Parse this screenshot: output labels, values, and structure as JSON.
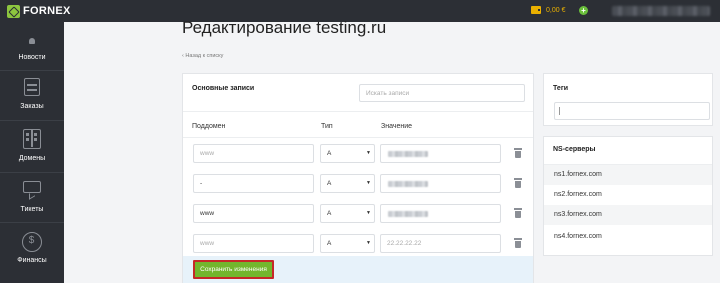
{
  "brand": {
    "name": "FORNEX"
  },
  "topbar": {
    "balance": "0,00 €",
    "add_symbol": "+"
  },
  "sidebar": {
    "items": [
      {
        "label": "Новости",
        "icon": "bell-icon"
      },
      {
        "label": "Заказы",
        "icon": "orders-icon"
      },
      {
        "label": "Домены",
        "icon": "domains-icon"
      },
      {
        "label": "Тикеты",
        "icon": "chat-icon"
      },
      {
        "label": "Финансы",
        "icon": "coin-icon"
      }
    ]
  },
  "page": {
    "title": "Редактирование testing.ru",
    "back_link": "Назад к списку"
  },
  "dns": {
    "title": "Основные записи",
    "search_placeholder": "Искать записи",
    "columns": {
      "subdomain": "Поддомен",
      "type": "Тип",
      "value": "Значение"
    },
    "rows": [
      {
        "subdomain": "www",
        "subdomain_is_placeholder": true,
        "type": "A",
        "value": ""
      },
      {
        "subdomain": "-",
        "subdomain_is_placeholder": false,
        "type": "A",
        "value": ""
      },
      {
        "subdomain": "www",
        "subdomain_is_placeholder": false,
        "type": "A",
        "value": ""
      },
      {
        "subdomain": "www",
        "subdomain_is_placeholder": true,
        "type": "A",
        "value": "22.22.22.22",
        "value_is_placeholder": true
      }
    ],
    "save_label": "Сохранить изменения"
  },
  "tags": {
    "title": "Теги"
  },
  "ns": {
    "title": "NS-серверы",
    "servers": [
      "ns1.fornex.com",
      "ns2.fornex.com",
      "ns3.fornex.com",
      "ns4.fornex.com"
    ]
  },
  "colors": {
    "sidebar_bg": "#2c2f35",
    "accent_green": "#73b62d",
    "balance_yellow": "#e9b000",
    "save_outline": "#c62828"
  }
}
